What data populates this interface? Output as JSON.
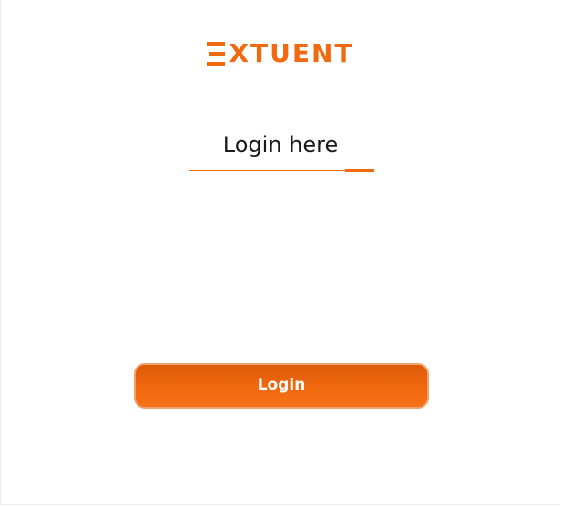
{
  "brand": {
    "logo_text": "XTUENT",
    "accent_color": "#f26a10"
  },
  "form": {
    "heading": "Login here",
    "submit_label": "Login"
  }
}
